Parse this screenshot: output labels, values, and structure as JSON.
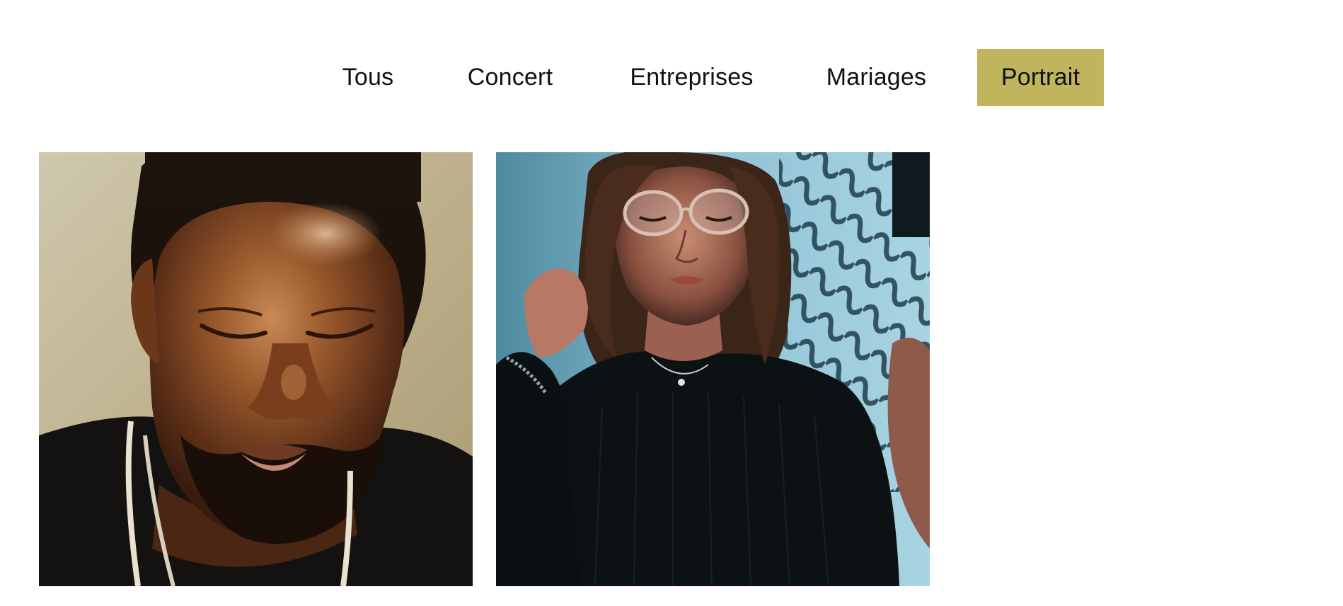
{
  "filters": {
    "items": [
      {
        "label": "Tous",
        "active": false
      },
      {
        "label": "Concert",
        "active": false
      },
      {
        "label": "Entreprises",
        "active": false
      },
      {
        "label": "Mariages",
        "active": false
      },
      {
        "label": "Portrait",
        "active": true
      }
    ],
    "active_color": "#c0b45d"
  },
  "gallery": {
    "photos": [
      {
        "subject": "portrait-man-eyes-closed"
      },
      {
        "subject": "portrait-woman-glasses-fence"
      }
    ]
  }
}
